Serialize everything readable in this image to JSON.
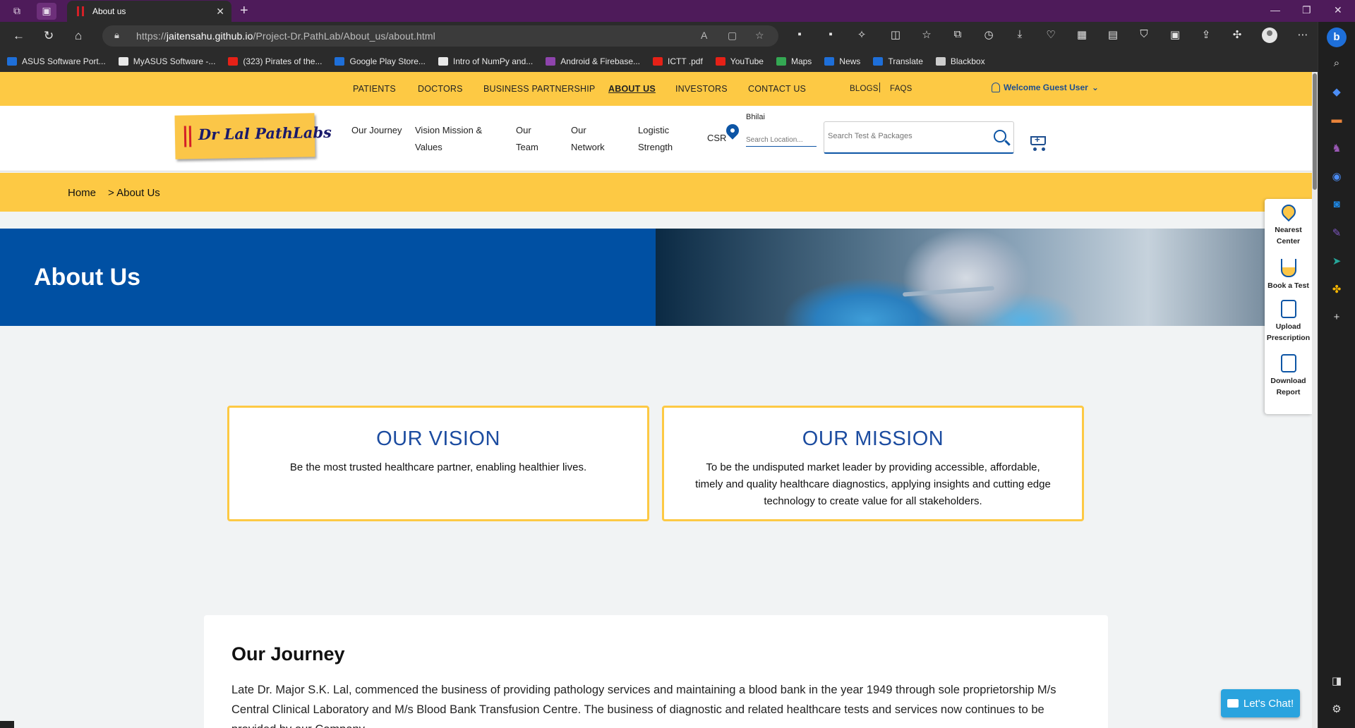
{
  "browser": {
    "tab_title": "About us",
    "url_prefix": "https://",
    "url_host": "jaitensahu.github.io",
    "url_path": "/Project-Dr.PathLab/About_us/about.html",
    "bookmarks": [
      {
        "label": "ASUS Software Port...",
        "color": "#1e6fd9"
      },
      {
        "label": "MyASUS Software -...",
        "color": "#e8e8e8"
      },
      {
        "label": "(323) Pirates of the...",
        "color": "#e62117"
      },
      {
        "label": "Google Play Store...",
        "color": "#1e6fd9"
      },
      {
        "label": "Intro of NumPy and...",
        "color": "#e8e8e8"
      },
      {
        "label": "Android & Firebase...",
        "color": "#8e44ad"
      },
      {
        "label": "ICTT .pdf",
        "color": "#e62117"
      },
      {
        "label": "YouTube",
        "color": "#e62117"
      },
      {
        "label": "Maps",
        "color": "#34a853"
      },
      {
        "label": "News",
        "color": "#1e6fd9"
      },
      {
        "label": "Translate",
        "color": "#1e6fd9"
      },
      {
        "label": "Blackbox",
        "color": "#cccccc"
      }
    ]
  },
  "topnav": {
    "links": [
      "PATIENTS",
      "DOCTORS",
      "BUSINESS PARTNERSHIP",
      "ABOUT US",
      "INVESTORS",
      "CONTACT US",
      "BLOGS",
      "FAQS"
    ],
    "welcome": "Welcome Guest User"
  },
  "header": {
    "logo_text": "Dr Lal PathLabs",
    "subnav": [
      "Our Journey",
      "Vision Mission & Values",
      "Our Team",
      "Our Network",
      "Logistic Strength"
    ],
    "csr": "CSR",
    "city": "Bhilai",
    "location_placeholder": "Search Location...",
    "search_placeholder": "Search Test & Packages"
  },
  "breadcrumb": {
    "home": "Home",
    "current": "> About Us"
  },
  "banner": {
    "title": "About Us"
  },
  "side_widget": [
    "Nearest Center",
    "Book a Test",
    "Upload Prescription",
    "Download Report"
  ],
  "vision": {
    "title": "OUR VISION",
    "text": "Be the most trusted healthcare partner, enabling healthier lives."
  },
  "mission": {
    "title": "OUR MISSION",
    "text": "To be the undisputed market leader by providing accessible, affordable, timely and quality healthcare diagnostics, applying insights and cutting edge technology to create value for all stakeholders."
  },
  "journey": {
    "title": "Our Journey",
    "text": "Late Dr. Major S.K. Lal, commenced the business of providing pathology services and maintaining a blood bank in the year 1949 through sole proprietorship M/s Central Clinical Laboratory and M/s Blood Bank Transfusion Centre. The business of diagnostic and related healthcare tests and services now continues to be provided by our Company."
  },
  "chat": {
    "label": "Let's Chat!"
  },
  "colors": {
    "brand_yellow": "#fdc944",
    "brand_blue": "#0050a3",
    "heading_blue": "#1c4ca0"
  }
}
